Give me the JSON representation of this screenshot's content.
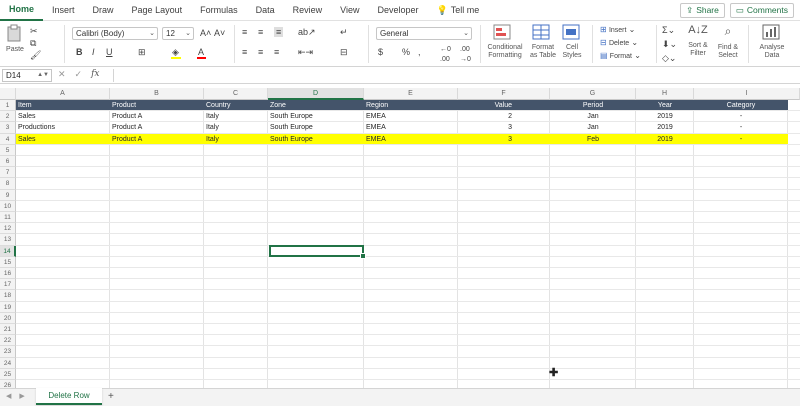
{
  "ribbon_tabs": [
    "Home",
    "Insert",
    "Draw",
    "Page Layout",
    "Formulas",
    "Data",
    "Review",
    "View",
    "Developer"
  ],
  "tell_me": "Tell me",
  "share_label": "Share",
  "comments_label": "Comments",
  "clipboard": {
    "paste": "Paste"
  },
  "font": {
    "name": "Calibri (Body)",
    "size": "12"
  },
  "number_format": "General",
  "styles": {
    "conditional": "Conditional\nFormatting",
    "format_table": "Format\nas Table",
    "cell_styles": "Cell\nStyles"
  },
  "cells_group": {
    "insert": "Insert",
    "delete": "Delete",
    "format": "Format"
  },
  "editing": {
    "sort": "Sort &\nFilter",
    "find": "Find &\nSelect",
    "analyse": "Analyse\nData"
  },
  "name_box": "D14",
  "fx": "fx",
  "columns": [
    "A",
    "B",
    "C",
    "D",
    "E",
    "F",
    "G",
    "H",
    "I"
  ],
  "selected_column": "D",
  "selected_row": 14,
  "row_numbers": [
    "1",
    "2",
    "3",
    "4",
    "5",
    "6",
    "7",
    "8",
    "9",
    "10",
    "11",
    "12",
    "13",
    "14",
    "15",
    "16",
    "17",
    "18",
    "19",
    "20",
    "21",
    "22",
    "23",
    "24",
    "25",
    "26"
  ],
  "header_row": [
    "Item",
    "Product",
    "Country",
    "Zone",
    "Region",
    "Value",
    "Period",
    "Year",
    "Category"
  ],
  "data_rows": [
    [
      "Sales",
      "Product A",
      "Italy",
      "South Europe",
      "EMEA",
      "2",
      "Jan",
      "2019",
      "-"
    ],
    [
      "Productions",
      "Product A",
      "Italy",
      "South Europe",
      "EMEA",
      "3",
      "Jan",
      "2019",
      "-"
    ],
    [
      "Sales",
      "Product A",
      "Italy",
      "South Europe",
      "EMEA",
      "3",
      "Feb",
      "2019",
      "-"
    ]
  ],
  "highlight_row_index": 2,
  "colors": {
    "header_bg": "#44546a",
    "highlight": "#ffff00",
    "accent": "#217346"
  },
  "sheet_tab": "Delete Row",
  "add_sheet": "+"
}
